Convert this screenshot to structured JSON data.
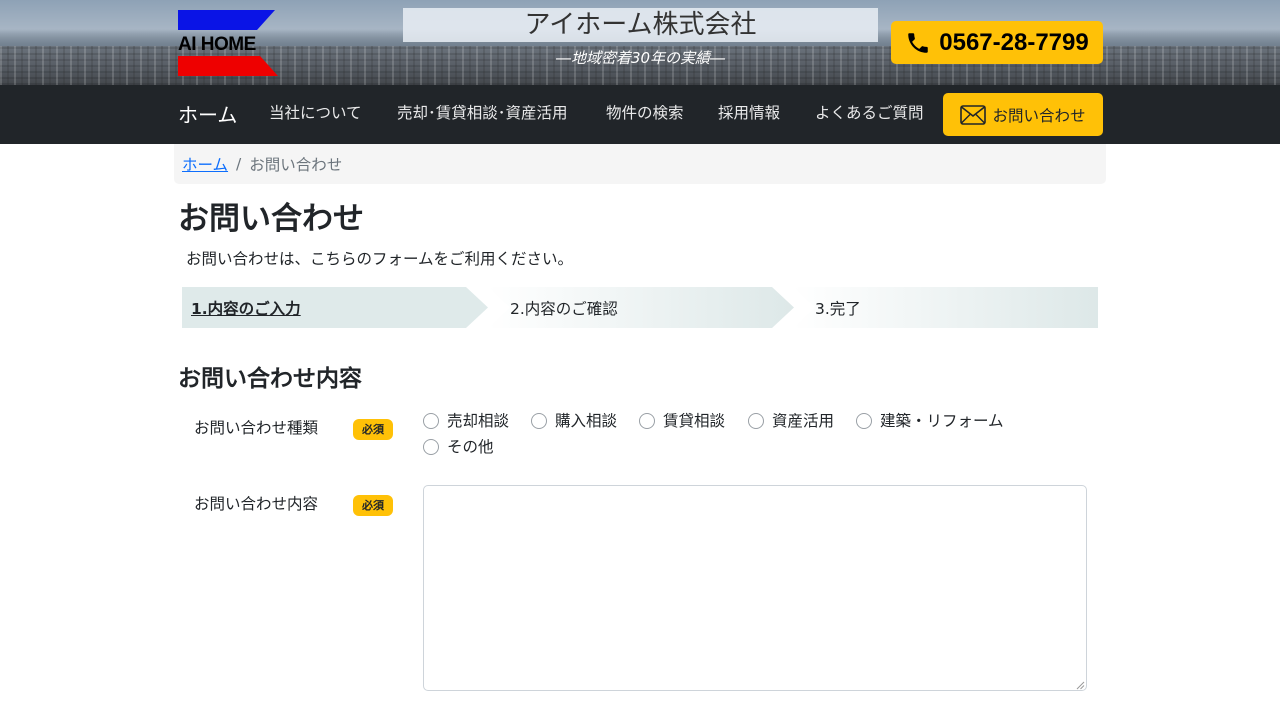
{
  "header": {
    "logo_text": "AI HOME",
    "company_name": "アイホーム株式会社",
    "tagline": "―地域密着30年の実績―",
    "phone": "0567-28-7799",
    "phone_icon": "phone-icon"
  },
  "nav": {
    "brand": "ホーム",
    "items": [
      {
        "label": "当社について"
      },
      {
        "label": "売却･賃貸相談･資産活用"
      },
      {
        "label": "物件の検索"
      },
      {
        "label": "採用情報"
      },
      {
        "label": "よくあるご質問"
      }
    ],
    "contact_label": "お問い合わせ",
    "contact_icon": "mail-icon"
  },
  "breadcrumb": {
    "home": "ホーム",
    "separator": "/",
    "current": "お問い合わせ"
  },
  "page": {
    "title": "お問い合わせ",
    "description": "お問い合わせは、こちらのフォームをご利用ください。"
  },
  "steps": [
    {
      "label": "1.内容のご入力",
      "active": true
    },
    {
      "label": "2.内容のご確認",
      "active": false
    },
    {
      "label": "3.完了",
      "active": false
    }
  ],
  "form": {
    "section_title": "お問い合わせ内容",
    "required_label": "必須",
    "type_field": {
      "label": "お問い合わせ種類",
      "options": [
        "売却相談",
        "購入相談",
        "賃貸相談",
        "資産活用",
        "建築・リフォーム",
        "その他"
      ]
    },
    "content_field": {
      "label": "お問い合わせ内容",
      "value": ""
    }
  },
  "colors": {
    "accent": "#ffc107",
    "navbar": "#212529",
    "link": "#0d6efd",
    "step_bg": "#dfeaea"
  }
}
